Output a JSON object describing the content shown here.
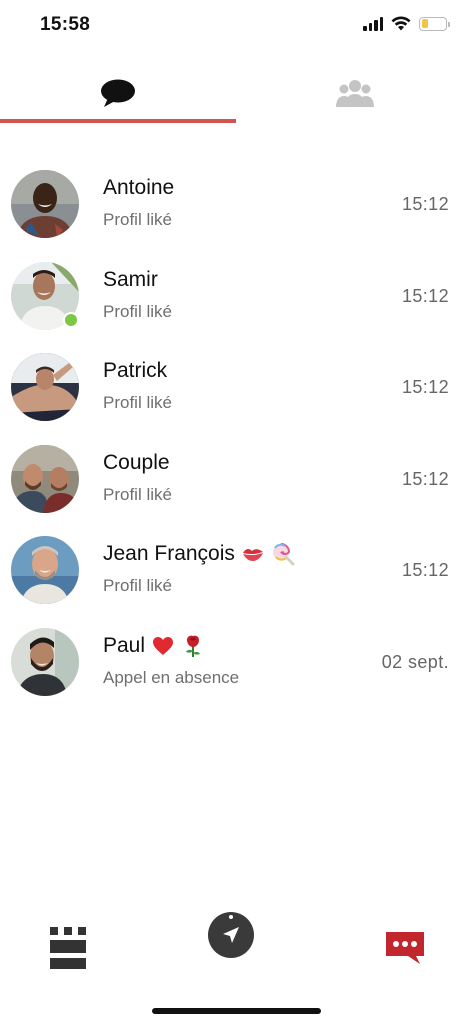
{
  "status_bar": {
    "time": "15:58",
    "signal_icon": "cellular-signal-icon",
    "wifi_icon": "wifi-icon",
    "battery_icon": "battery-icon",
    "battery_level": 0.3,
    "battery_color": "#f3c443"
  },
  "top_tabs": [
    {
      "name": "messages",
      "icon": "chat-bubble-icon",
      "active": true
    },
    {
      "name": "groups",
      "icon": "group-icon",
      "active": false
    }
  ],
  "accent_color": "#d2544c",
  "conversations": [
    {
      "name": "Antoine",
      "emojis": [],
      "subtitle": "Profil liké",
      "time": "15:12",
      "online": false
    },
    {
      "name": "Samir",
      "emojis": [],
      "subtitle": "Profil liké",
      "time": "15:12",
      "online": true
    },
    {
      "name": "Patrick",
      "emojis": [],
      "subtitle": "Profil liké",
      "time": "15:12",
      "online": false
    },
    {
      "name": "Couple",
      "emojis": [],
      "subtitle": "Profil liké",
      "time": "15:12",
      "online": false
    },
    {
      "name": "Jean François",
      "emojis": [
        "kiss-mark-emoji",
        "lollipop-emoji"
      ],
      "subtitle": "Profil liké",
      "time": "15:12",
      "online": false
    },
    {
      "name": "Paul",
      "emojis": [
        "red-heart-emoji",
        "rose-emoji"
      ],
      "subtitle": "Appel en absence",
      "time": "02 sept.",
      "online": false
    }
  ],
  "online_color": "#7dc646",
  "bottom_nav": [
    {
      "name": "grid",
      "icon": "grid-icon"
    },
    {
      "name": "explore",
      "icon": "compass-navigation-icon"
    },
    {
      "name": "messages",
      "icon": "message-dots-icon",
      "active": true
    }
  ]
}
